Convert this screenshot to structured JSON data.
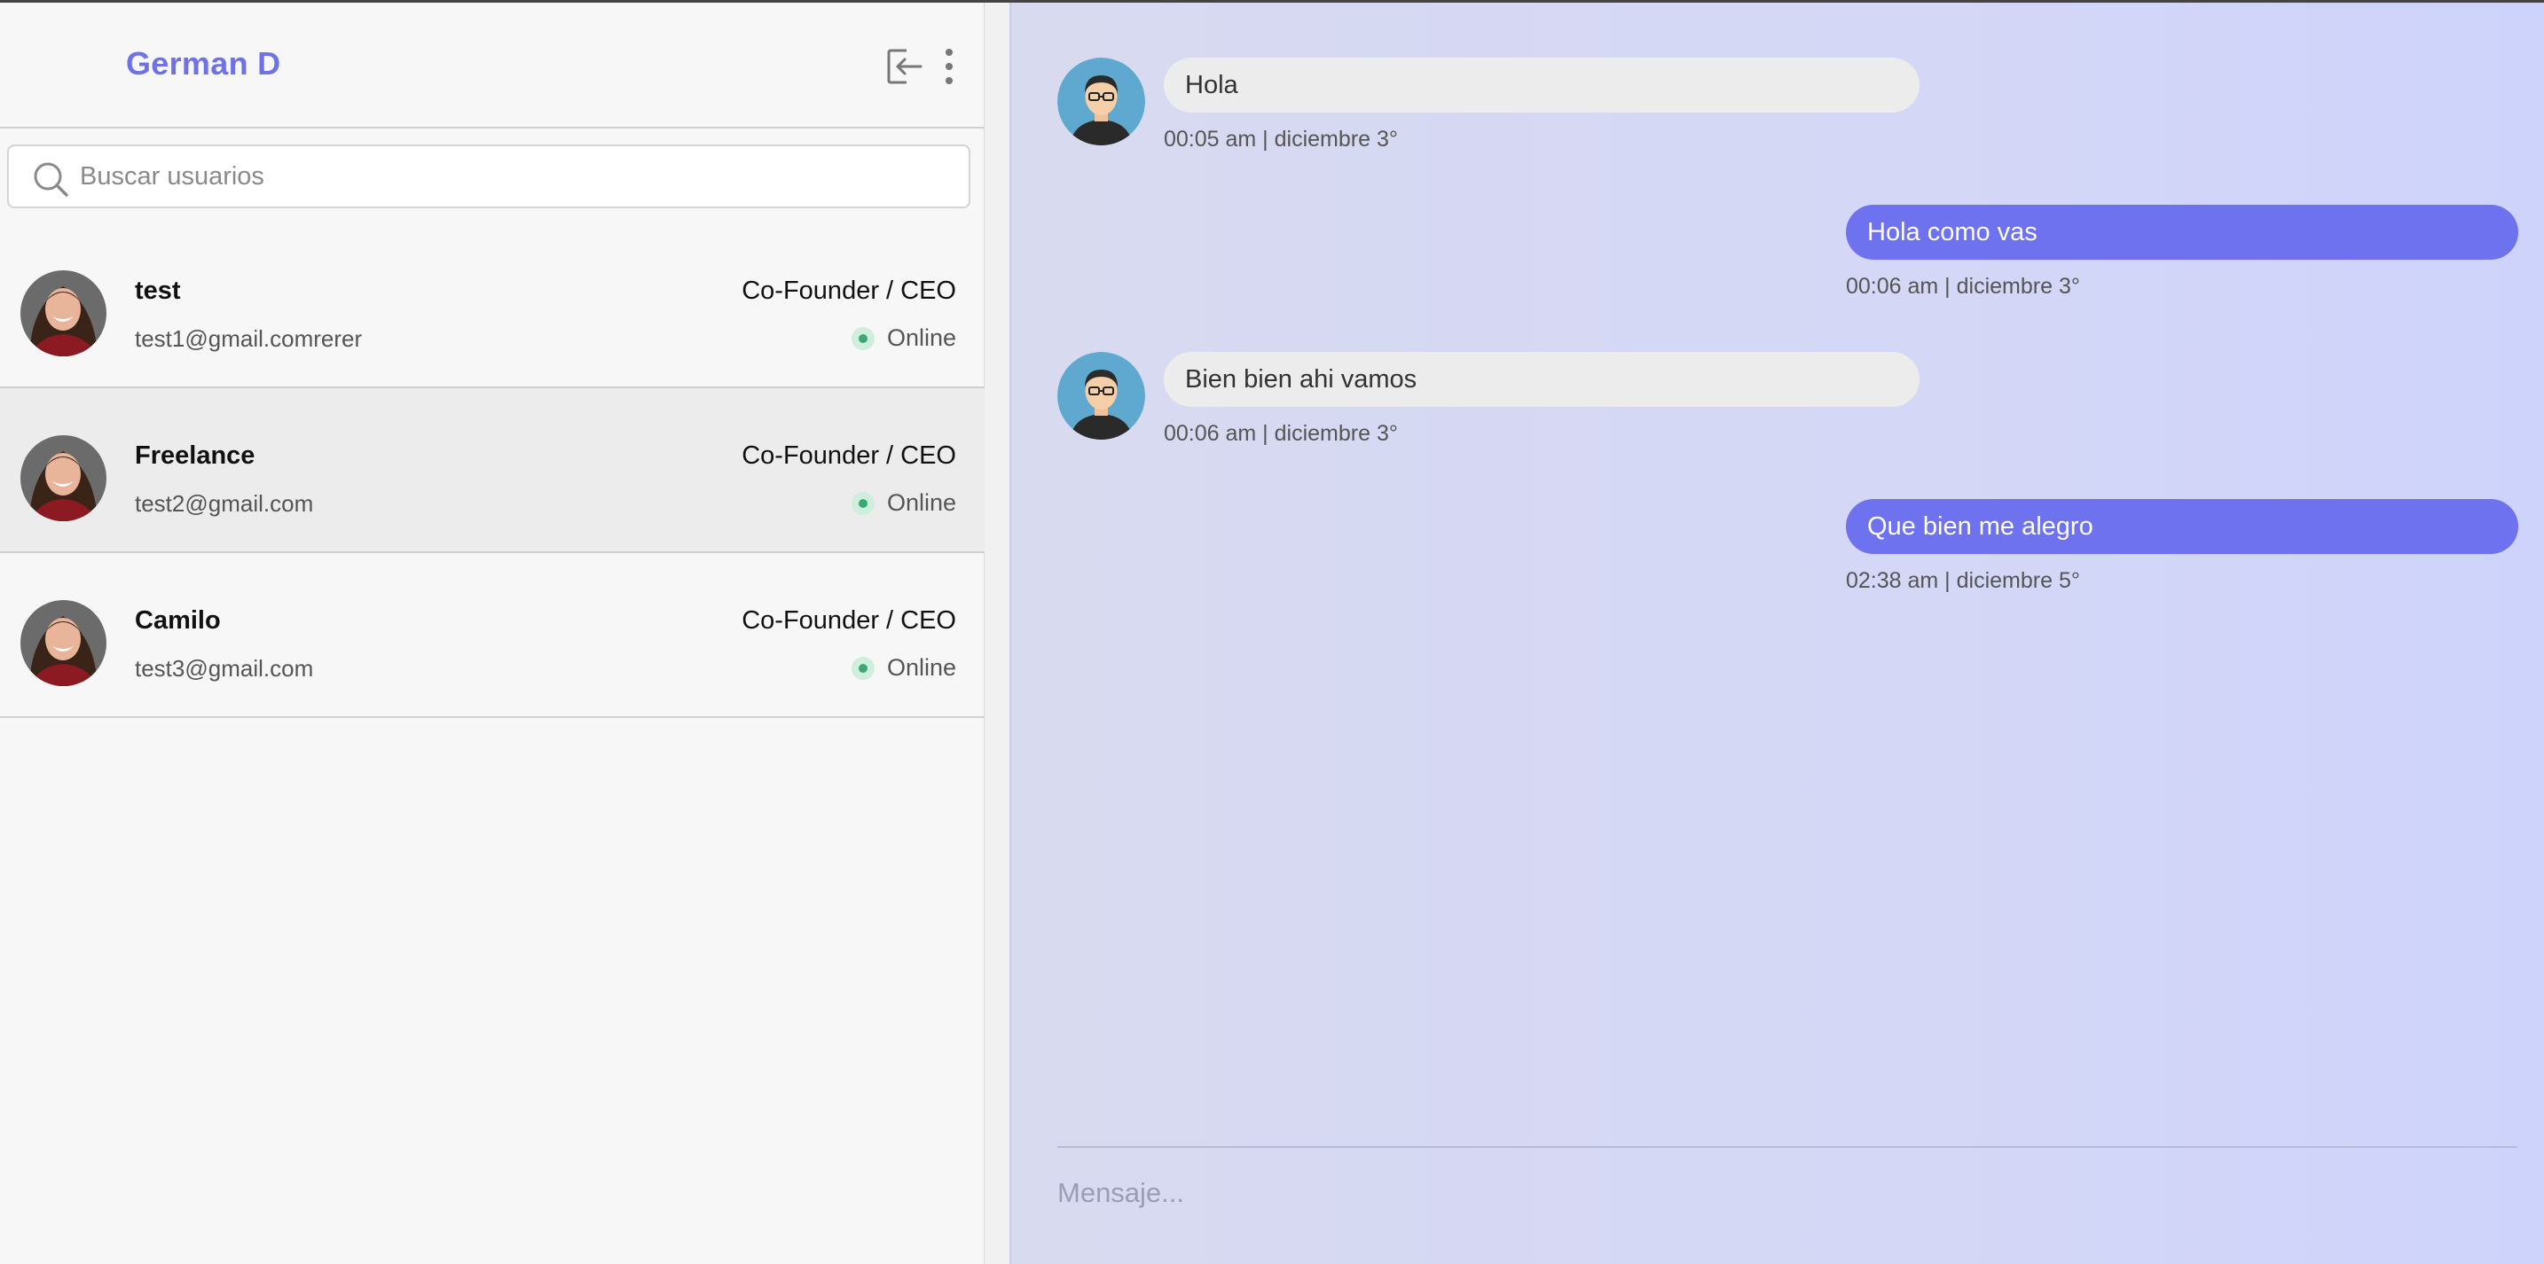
{
  "header": {
    "title": "German D",
    "logout_icon": "logout-icon",
    "more_icon": "more-vertical-icon"
  },
  "search": {
    "placeholder": "Buscar usuarios",
    "value": "",
    "icon": "search-icon"
  },
  "users": [
    {
      "name": "test",
      "email": "test1@gmail.comrerer",
      "role": "Co-Founder / CEO",
      "status": "Online",
      "active": false
    },
    {
      "name": "Freelance",
      "email": "test2@gmail.com",
      "role": "Co-Founder / CEO",
      "status": "Online",
      "active": true
    },
    {
      "name": "Camilo",
      "email": "test3@gmail.com",
      "role": "Co-Founder / CEO",
      "status": "Online",
      "active": false
    }
  ],
  "messages": [
    {
      "direction": "in",
      "text": "Hola",
      "time": "00:05 am | diciembre 3°"
    },
    {
      "direction": "out",
      "text": "Hola como vas",
      "time": "00:06 am | diciembre 3°"
    },
    {
      "direction": "in",
      "text": "Bien bien ahi vamos",
      "time": "00:06 am | diciembre 3°"
    },
    {
      "direction": "out",
      "text": "Que bien me alegro",
      "time": "02:38 am | diciembre 5°"
    }
  ],
  "composer": {
    "placeholder": "Mensaje...",
    "value": ""
  },
  "colors": {
    "accent": "#6f72ee",
    "title": "#6f72e6",
    "online": "#3aa874"
  }
}
